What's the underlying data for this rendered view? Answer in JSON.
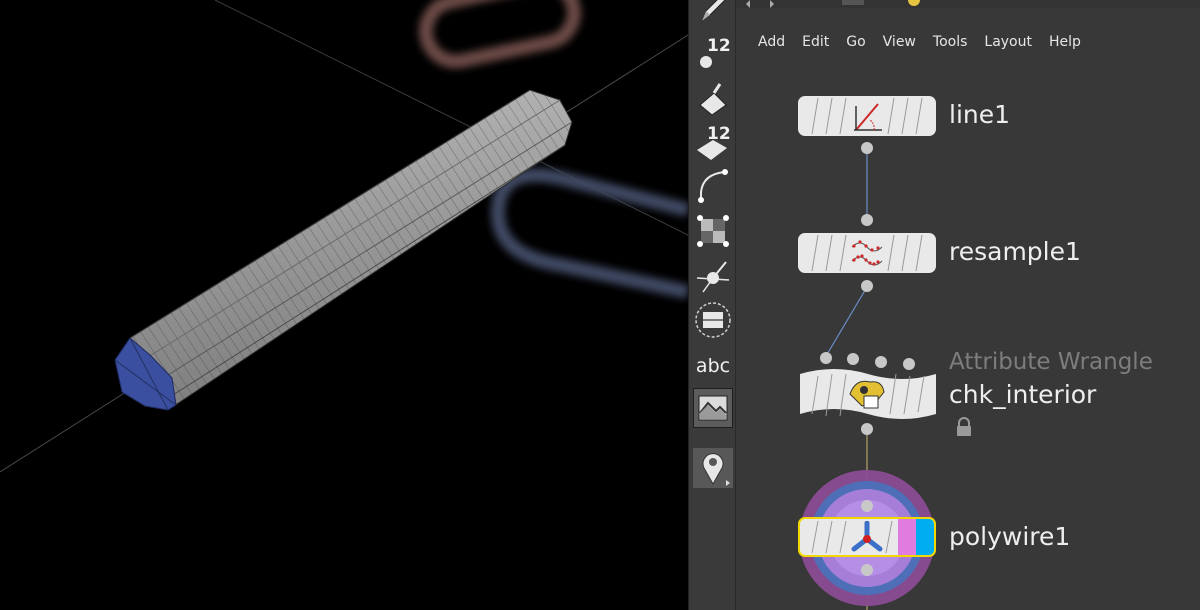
{
  "menubar": {
    "items": [
      "Add",
      "Edit",
      "Go",
      "View",
      "Tools",
      "Layout",
      "Help"
    ]
  },
  "toolbar": {
    "tools": [
      {
        "icon": "pencil-icon"
      },
      {
        "icon": "point-count-icon",
        "label": "12"
      },
      {
        "icon": "bucket-icon"
      },
      {
        "icon": "prim-count-icon",
        "label": "12"
      },
      {
        "icon": "curve-icon"
      },
      {
        "icon": "checker-icon"
      },
      {
        "icon": "normals-icon"
      },
      {
        "icon": "template-icon"
      },
      {
        "icon": "text-display-icon",
        "label": "abc"
      },
      {
        "icon": "background-image-icon"
      },
      {
        "icon": "pin-icon"
      }
    ]
  },
  "nodes": [
    {
      "name": "line1",
      "icon": "line-icon"
    },
    {
      "name": "resample1",
      "icon": "resample-icon"
    },
    {
      "type_label": "Attribute Wrangle",
      "name": "chk_interior",
      "icon": "wrangle-icon",
      "locked": true
    },
    {
      "name": "polywire1",
      "icon": "polywire-icon",
      "display_flag": true,
      "selected": true
    }
  ],
  "colors": {
    "viewport_bg": "#000000",
    "panel_bg": "#383838",
    "toolbar_bg": "#3a3a3a",
    "node_body": "#e9e9e9",
    "selected_outline": "#f2d800",
    "display_flag": "#00aef0",
    "render_flag": "#e07ce0",
    "wire": "#6a8fc8"
  }
}
